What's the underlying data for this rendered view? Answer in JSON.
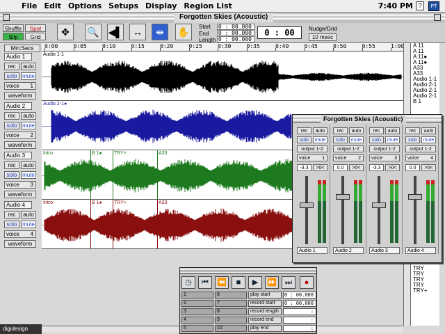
{
  "menubar": {
    "items": [
      "File",
      "Edit",
      "Options",
      "Setups",
      "Display",
      "Region List"
    ],
    "clock": "7:40 PM"
  },
  "window": {
    "title": "Forgotten Skies (Acoustic)"
  },
  "toolbar": {
    "modes": [
      "Shuffle",
      "Spot",
      "Slip",
      "Grid"
    ],
    "start_label": "Start",
    "end_label": "End",
    "length_label": "Length",
    "start_value": "0 : 00.000",
    "end_value": "0 : 00.000",
    "length_value": "0 : 00.000",
    "main_counter": "0 : 00",
    "nudge_label": "Nudge/Grid",
    "nudge_value": "10 msec"
  },
  "ruler": {
    "button": "Min:Secs",
    "ticks": [
      "0:00",
      "0:05",
      "0:10",
      "0:15",
      "0:20",
      "0:25",
      "0:30",
      "0:35",
      "0:40",
      "0:45",
      "0:50",
      "0:55",
      "1:00"
    ]
  },
  "tracks": [
    {
      "name": "Audio 1",
      "rec": "rec",
      "auto": "auto",
      "solo": "solo",
      "mute": "mute",
      "voice": "voice",
      "voice_num": "1",
      "view": "waveform",
      "color": "#000000",
      "regions": [
        "Audio 1-1"
      ]
    },
    {
      "name": "Audio 2",
      "rec": "rec",
      "auto": "auto",
      "solo": "solo",
      "mute": "mute",
      "voice": "voice",
      "voice_num": "2",
      "view": "waveform",
      "color": "#1a1aa0",
      "regions": [
        "Audio 2-1●"
      ]
    },
    {
      "name": "Audio 3",
      "rec": "rec",
      "auto": "auto",
      "solo": "solo",
      "mute": "mute",
      "voice": "voice",
      "voice_num": "3",
      "view": "waveform",
      "color": "#1e7a1e",
      "regions": [
        "Intro",
        "B 1●",
        "TRY+",
        "A33"
      ]
    },
    {
      "name": "Audio 4",
      "rec": "rec",
      "auto": "auto",
      "solo": "solo",
      "mute": "mute",
      "voice": "voice",
      "voice_num": "4",
      "view": "waveform",
      "color": "#8a1010",
      "regions": [
        "Intro",
        "B 1●",
        "TRY+",
        "A33"
      ]
    }
  ],
  "region_list": {
    "items": [
      "A 11",
      "A 11",
      "A 11●",
      "A 11●",
      "A33",
      "A33",
      "Audio 1-1",
      "Audio 2-1",
      "Audio 2-1",
      "Audio 2-1",
      "B 1",
      "",
      "",
      "",
      "",
      "",
      "",
      "",
      "",
      "",
      "",
      "",
      "",
      "",
      "",
      "",
      "",
      "",
      "",
      "",
      "",
      "",
      "",
      "",
      "",
      "",
      "",
      "",
      "",
      "",
      "TRY",
      "TRY",
      "TRY",
      "TRY",
      "TRY+"
    ]
  },
  "mixer": {
    "title": "Forgotten Skies (Acoustic)",
    "strips": [
      {
        "name": "Audio 1",
        "output": "output 1-2",
        "voice": "voice",
        "voice_num": "1",
        "pan": "-3.3",
        "pan2": ">0<"
      },
      {
        "name": "Audio 2",
        "output": "output 1-2",
        "voice": "voice",
        "voice_num": "2",
        "pan": "0.0",
        "pan2": ">0<"
      },
      {
        "name": "Audio 3",
        "output": "output 1-2",
        "voice": "voice",
        "voice_num": "3",
        "pan": "-3.3",
        "pan2": ">0<"
      },
      {
        "name": "Audio 4",
        "output": "output 1-2",
        "voice": "voice",
        "voice_num": "4",
        "pan": "0.0",
        "pan2": ">0<"
      }
    ],
    "labels": {
      "rec": "rec",
      "auto": "auto",
      "solo": "solo",
      "mute": "mute"
    }
  },
  "transport": {
    "memory": [
      "1",
      "2",
      "3",
      "4",
      "5",
      "6",
      "7",
      "8",
      "9",
      "10"
    ],
    "fields": [
      {
        "label": "play start",
        "value": "0 : 00.000"
      },
      {
        "label": "record start",
        "value": "0 : 00.000"
      },
      {
        "label": "record length",
        "value": ":"
      },
      {
        "label": "record end",
        "value": ":"
      },
      {
        "label": "play end",
        "value": ":"
      }
    ]
  },
  "branding": {
    "logo": "digidesign"
  }
}
